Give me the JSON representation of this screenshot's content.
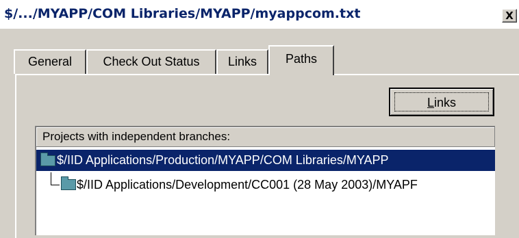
{
  "window": {
    "title": "$/.../MYAPP/COM Libraries/MYAPP/myappcom.txt",
    "close_label": "X"
  },
  "tabs": [
    {
      "label": "General",
      "active": false
    },
    {
      "label": "Check Out Status",
      "active": false
    },
    {
      "label": "Links",
      "active": false
    },
    {
      "label": "Paths",
      "active": true
    }
  ],
  "links_button": {
    "label_accel": "L",
    "label_rest": "inks"
  },
  "list": {
    "header": "Projects with independent branches:",
    "items": [
      {
        "path": "$/IID Applications/Production/MYAPP/COM Libraries/MYAPP",
        "selected": true,
        "icon": "folder-icon"
      },
      {
        "path": "$/IID Applications/Development/CC001 (28 May 2003)/MYAPF",
        "selected": false,
        "icon": "folder-icon"
      }
    ]
  },
  "colors": {
    "selection": "#0a246a",
    "title_text": "#0a246a",
    "dialog_face": "#d4d0c8",
    "folder": "#5a9aa8"
  }
}
